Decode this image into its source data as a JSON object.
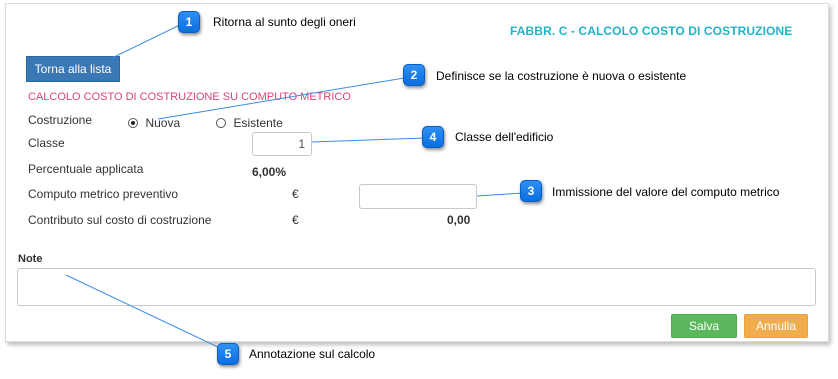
{
  "header": {
    "title": "FABBR. C - CALCOLO COSTO DI COSTRUZIONE"
  },
  "toolbar": {
    "back_label": "Torna alla lista"
  },
  "section": {
    "title": "CALCOLO COSTO DI COSTRUZIONE SU COMPUTO METRICO"
  },
  "form": {
    "costruzione_label": "Costruzione",
    "options": [
      {
        "label": "Nuova",
        "selected": true
      },
      {
        "label": "Esistente",
        "selected": false
      }
    ],
    "classe_label": "Classe",
    "classe_value": "1",
    "percentuale_label": "Percentuale applicata",
    "percentuale_value": "6,00%",
    "computo_label": "Computo metrico preventivo",
    "computo_currency": "€",
    "computo_value": "",
    "contributo_label": "Contributo sul costo di costruzione",
    "contributo_currency": "€",
    "contributo_value": "0,00"
  },
  "note": {
    "label": "Note",
    "value": ""
  },
  "actions": {
    "save_label": "Salva",
    "cancel_label": "Annulla"
  },
  "callouts": [
    {
      "number": "1",
      "text": "Ritorna al sunto degli oneri"
    },
    {
      "number": "2",
      "text": "Definisce se la costruzione è nuova o esistente"
    },
    {
      "number": "3",
      "text": "Immissione del valore del computo metrico"
    },
    {
      "number": "4",
      "text": "Classe dell'edificio"
    },
    {
      "number": "5",
      "text": "Annotazione sul calcolo"
    }
  ],
  "colors": {
    "title": "#22b3c6",
    "section_title": "#e0417a",
    "back_button": "#3a78b5",
    "save_button": "#5cb85c",
    "cancel_button": "#f0ad4e",
    "callout": "#0b6fe0"
  }
}
